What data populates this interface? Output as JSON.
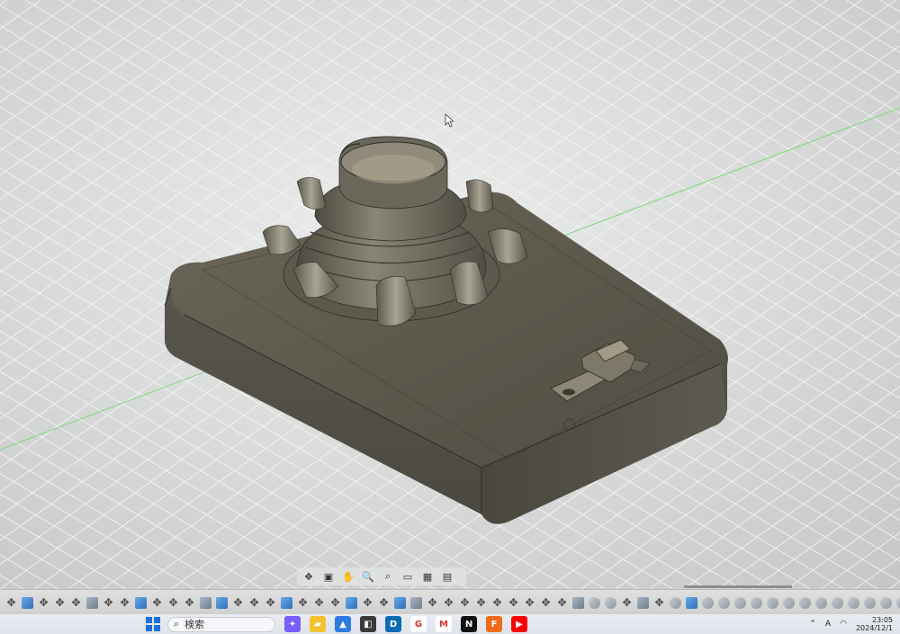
{
  "app": {
    "name": "CAD model viewport",
    "model": "enclosure-with-knob"
  },
  "nav_toolbar": {
    "items": [
      {
        "name": "orbit",
        "icon": "orbit-icon",
        "glyph": "✥"
      },
      {
        "name": "look-at",
        "icon": "look-at-icon",
        "glyph": "▣"
      },
      {
        "name": "pan",
        "icon": "pan-icon",
        "glyph": "✋"
      },
      {
        "name": "zoom",
        "icon": "zoom-icon",
        "glyph": "🔍"
      },
      {
        "name": "fit",
        "icon": "fit-icon",
        "glyph": "⌕"
      },
      {
        "name": "display-settings",
        "icon": "display-icon",
        "glyph": "▭"
      },
      {
        "name": "grid-settings",
        "icon": "grid-icon",
        "glyph": "▦"
      },
      {
        "name": "viewports",
        "icon": "viewports-icon",
        "glyph": "▤"
      }
    ]
  },
  "timeline": {
    "pattern": [
      "move",
      "body",
      "move",
      "move",
      "move",
      "sketch",
      "move",
      "move",
      "body",
      "move",
      "move",
      "move",
      "sketch",
      "body",
      "move",
      "move",
      "move",
      "body",
      "move",
      "move",
      "move",
      "body",
      "move",
      "move",
      "body",
      "sketch",
      "move",
      "move",
      "move",
      "move",
      "move",
      "move",
      "move",
      "move",
      "move",
      "sketch",
      "feature",
      "feature",
      "move",
      "sketch",
      "move",
      "feature",
      "body",
      "feature",
      "feature",
      "feature",
      "feature",
      "feature",
      "feature",
      "feature",
      "feature",
      "feature",
      "feature",
      "feature",
      "feature",
      "feature",
      "feature",
      "feature",
      "feature",
      "feature",
      "feature",
      "feature",
      "feature",
      "feature",
      "feature",
      "feature"
    ]
  },
  "taskbar": {
    "search_placeholder": "検索",
    "apps": [
      {
        "name": "copilot",
        "icon": "copilot-icon",
        "color": "#7b5cff",
        "glyph": "✦"
      },
      {
        "name": "file-explorer",
        "icon": "folder-icon",
        "color": "#f2c230",
        "glyph": "▰"
      },
      {
        "name": "photos",
        "icon": "photos-icon",
        "color": "#2d7be0",
        "glyph": "▲"
      },
      {
        "name": "store",
        "icon": "store-icon",
        "color": "#3a3a3a",
        "glyph": "◧"
      },
      {
        "name": "dell",
        "icon": "dell-icon",
        "color": "#0b6cb5",
        "glyph": "D"
      },
      {
        "name": "google",
        "icon": "google-icon",
        "color": "#ffffff",
        "glyph": "G"
      },
      {
        "name": "gmail",
        "icon": "gmail-icon",
        "color": "#ffffff",
        "glyph": "M"
      },
      {
        "name": "netflix",
        "icon": "netflix-icon",
        "color": "#111111",
        "glyph": "N"
      },
      {
        "name": "fusion",
        "icon": "fusion-icon",
        "color": "#f06a1a",
        "glyph": "F"
      },
      {
        "name": "youtube",
        "icon": "youtube-icon",
        "color": "#ff0000",
        "glyph": "▶"
      }
    ],
    "tray": {
      "chevron_icon": "chevron-up-icon",
      "ime": "A",
      "time": "23:05",
      "date": "2024/12/1"
    }
  },
  "colors": {
    "viewport_bg": "#d7d9d8",
    "grid_line": "#eef0ef",
    "model_top": "#5a564a",
    "model_side": "#4c493f",
    "axis_green": "#6fcf6a",
    "taskbar_accent": "#1e6fd9"
  }
}
